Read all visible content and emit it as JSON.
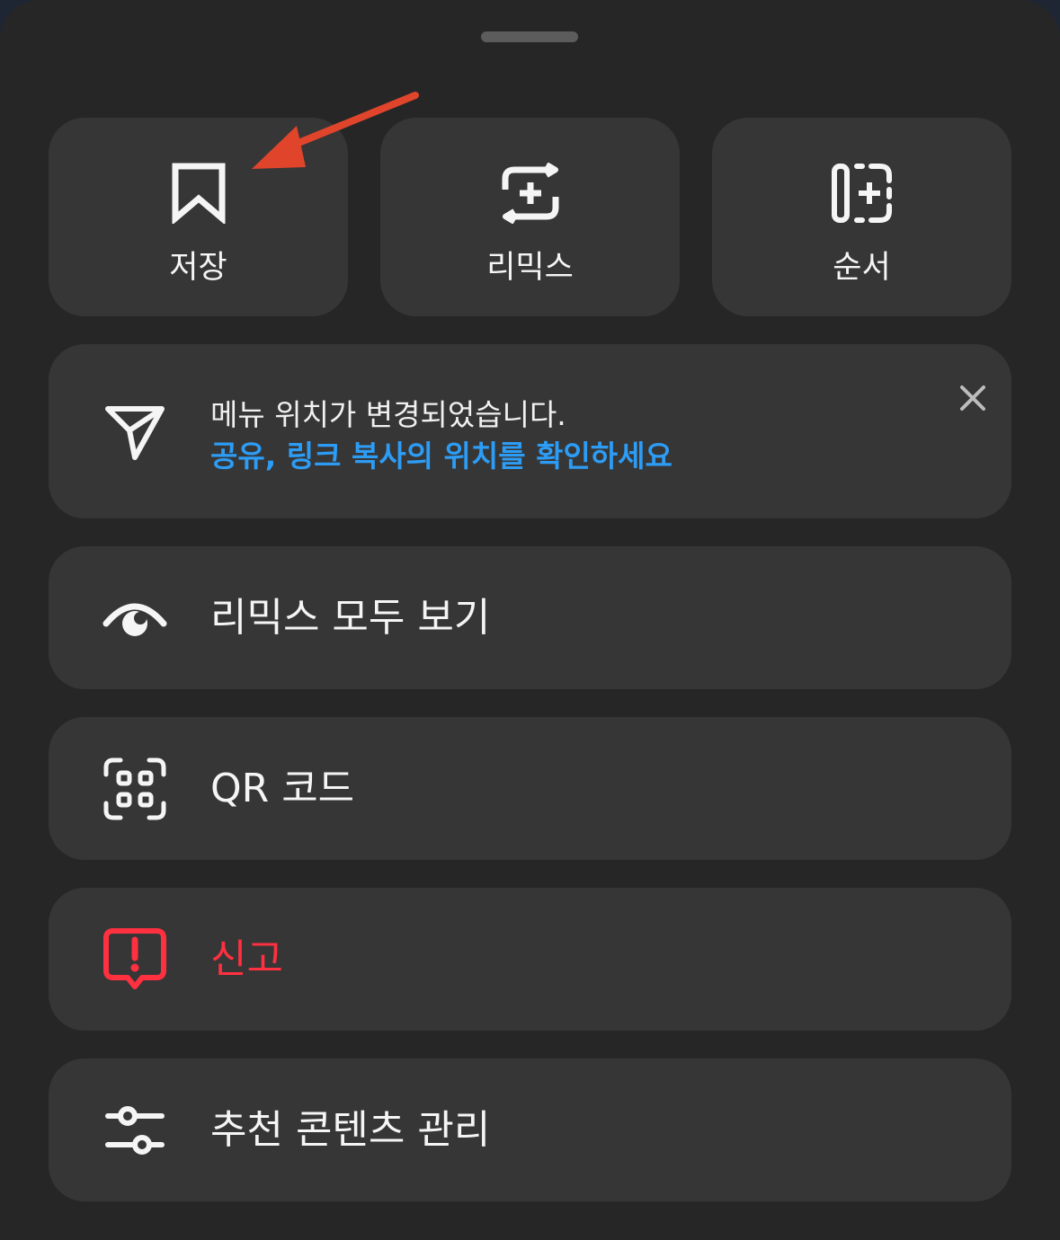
{
  "tiles": [
    {
      "label": "저장",
      "icon": "bookmark-icon"
    },
    {
      "label": "리믹스",
      "icon": "remix-icon"
    },
    {
      "label": "순서",
      "icon": "sequence-icon"
    }
  ],
  "notice": {
    "title": "메뉴 위치가 변경되었습니다.",
    "link": "공유, 링크 복사의 위치를 확인하세요",
    "icon": "send-icon"
  },
  "rows": [
    {
      "label": "리믹스 모두 보기",
      "icon": "eye-icon"
    },
    {
      "label": "QR 코드",
      "icon": "qr-code-icon"
    },
    {
      "label": "신고",
      "icon": "report-icon"
    },
    {
      "label": "추천 콘텐츠 관리",
      "icon": "sliders-icon"
    }
  ],
  "colors": {
    "background": "#262626",
    "tile": "#363636",
    "link": "#2d9cf5",
    "danger": "#ff3040",
    "annotation_arrow": "#e0452c"
  }
}
